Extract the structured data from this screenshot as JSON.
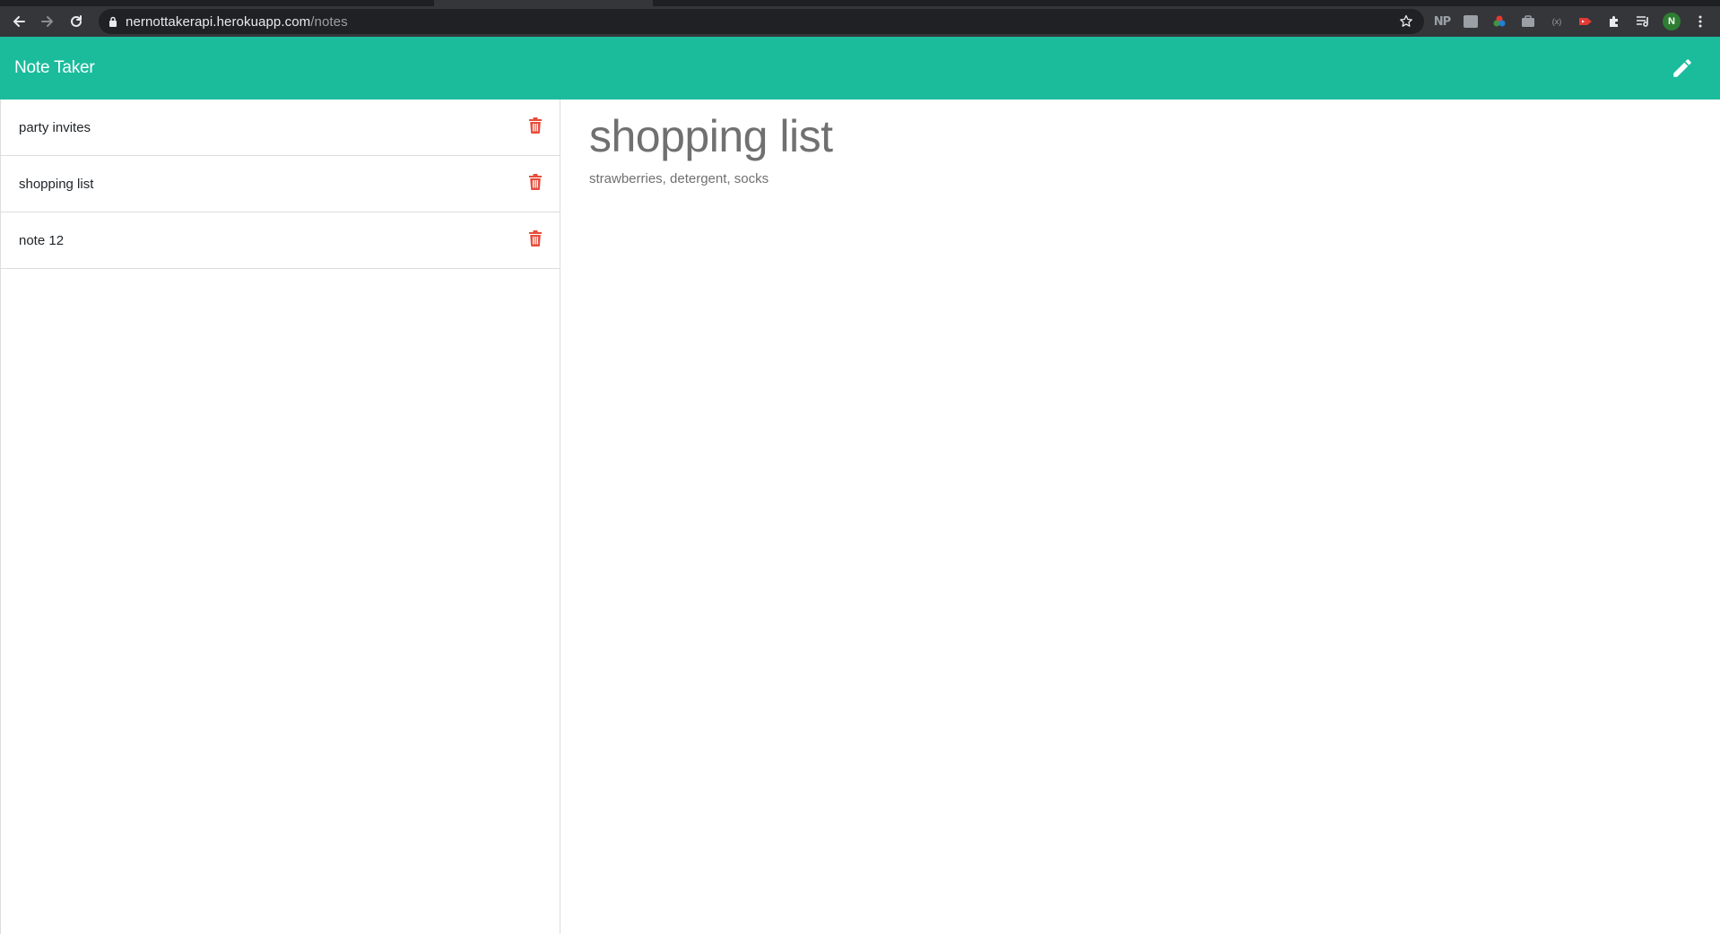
{
  "browser": {
    "url_host": "nernottakerapi.herokuapp.com",
    "url_path": "/notes",
    "extensions": [
      "np-extension-icon",
      "translate-extension-icon",
      "color-picker-extension-icon",
      "briefcase-extension-icon",
      "code-extension-icon",
      "video-extension-icon",
      "puzzle-extensions-icon",
      "reading-list-icon"
    ],
    "profile_initial": "N"
  },
  "app": {
    "title": "Note Taker",
    "accent_color": "#1abc9c",
    "delete_color": "#e74c3c"
  },
  "notes": [
    {
      "title": "party invites"
    },
    {
      "title": "shopping list"
    },
    {
      "title": "note 12"
    }
  ],
  "active_note": {
    "title": "shopping list",
    "text": "strawberries, detergent, socks"
  }
}
